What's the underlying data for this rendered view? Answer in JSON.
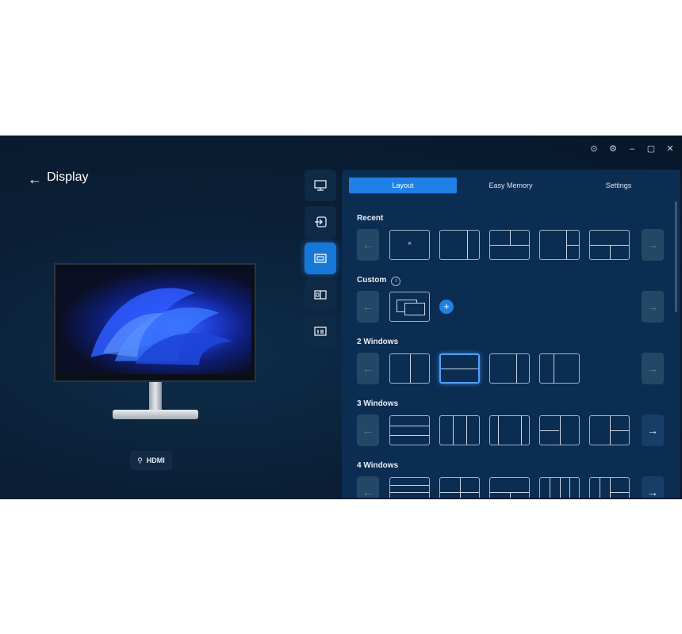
{
  "window": {
    "controls": [
      "⊙",
      "⚙",
      "–",
      "▢",
      "✕"
    ]
  },
  "header": {
    "back_icon": "arrow-left-icon",
    "title": "Display"
  },
  "input": {
    "label": "HDMI"
  },
  "rail": {
    "items": [
      "monitor-icon",
      "input-source-icon",
      "layout-icon",
      "pip-icon",
      "info-icon"
    ],
    "active_index": 2
  },
  "tabs": [
    {
      "label": "Layout",
      "active": true
    },
    {
      "label": "Easy Memory",
      "active": false
    },
    {
      "label": "Settings",
      "active": false
    }
  ],
  "sections": {
    "recent": "Recent",
    "custom": "Custom",
    "two": "2 Windows",
    "three": "3 Windows",
    "four": "4 Windows"
  },
  "recent_empty_mark": "×",
  "nav": {
    "left": "←",
    "right": "→"
  },
  "add_label": "+",
  "info_label": "i",
  "colors": {
    "background": "#0a1f36",
    "panel": "#0c2d52",
    "accent": "#1f80e6"
  }
}
